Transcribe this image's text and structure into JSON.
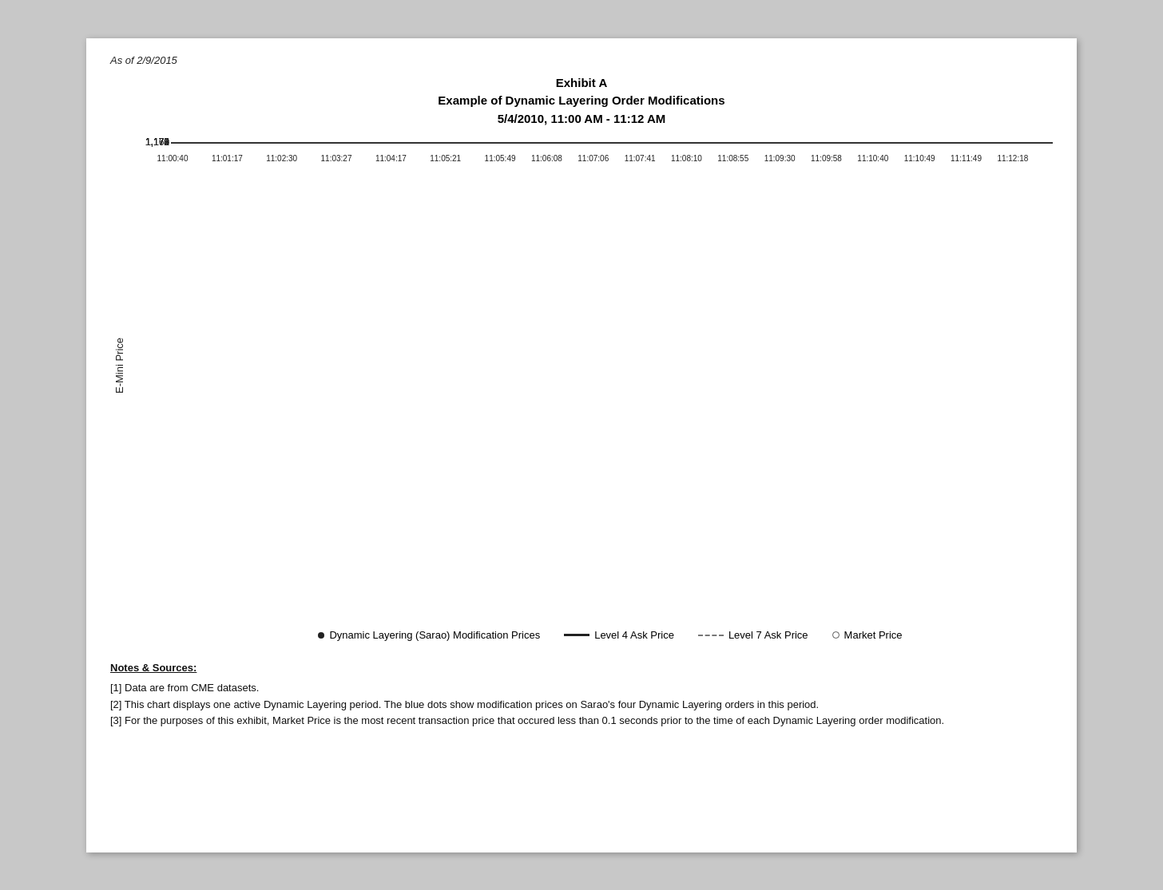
{
  "date_label": "As of 2/9/2015",
  "title_line1": "Exhibit A",
  "title_line2": "Example of Dynamic Layering Order Modifications",
  "title_line3": "5/4/2010, 11:00 AM - 11:12 AM",
  "y_axis_label": "E-Mini Price",
  "y_ticks": [
    {
      "label": "1,175",
      "pct": 0
    },
    {
      "label": "1,174",
      "pct": 16.67
    },
    {
      "label": "1,173",
      "pct": 33.33
    },
    {
      "label": "1,172",
      "pct": 50
    },
    {
      "label": "1,171",
      "pct": 66.67
    },
    {
      "label": "1,170",
      "pct": 83.33
    },
    {
      "label": "1,169",
      "pct": 100
    }
  ],
  "x_ticks": [
    "11:00:40",
    "11:01:17",
    "11:02:30",
    "11:03:27",
    "11:04:17",
    "11:05:21",
    "11:05:49",
    "11:06:08",
    "11:07:06",
    "11:07:41",
    "11:08:10",
    "11:08:55",
    "11:09:30",
    "11:09:58",
    "11:10:40",
    "11:10:49",
    "11:11:49",
    "11:12:18"
  ],
  "legend": [
    {
      "type": "dot",
      "label": "Dynamic Layering (Sarao) Modification Prices"
    },
    {
      "type": "solid",
      "label": "Level 4 Ask Price"
    },
    {
      "type": "dashed",
      "label": "Level 7 Ask Price"
    },
    {
      "type": "circle",
      "label": "Market Price"
    }
  ],
  "notes_header": "Notes & Sources:",
  "notes": [
    "[1] Data are from CME datasets.",
    "[2] This chart displays one active Dynamic Layering period. The blue dots show modification prices on Sarao's four Dynamic Layering orders in this period.",
    "[3] For the purposes of this exhibit, Market Price is the most recent transaction price that occured less than 0.1 seconds  prior to the time of each Dynamic Layering order modification."
  ]
}
